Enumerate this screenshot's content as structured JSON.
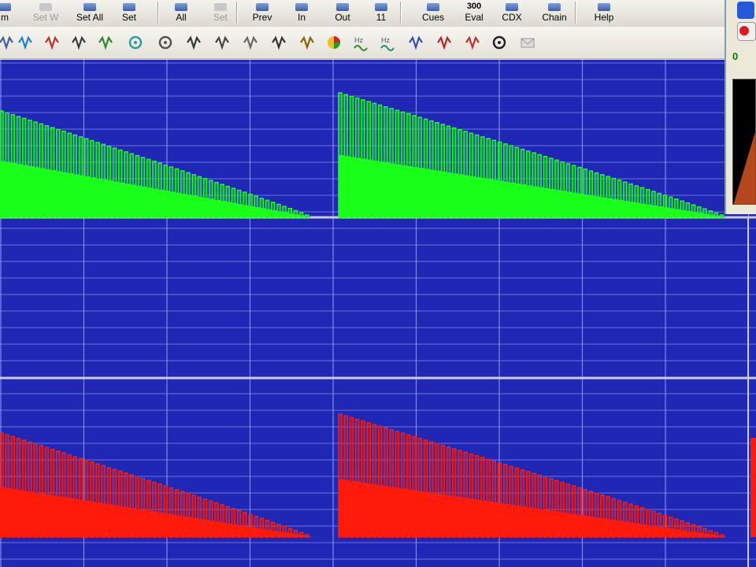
{
  "toolbar_top": {
    "buttons": [
      {
        "label": "m",
        "enabled": true
      },
      {
        "label": "Set W",
        "enabled": false
      },
      {
        "label": "Set All",
        "enabled": true
      },
      {
        "label": "Set",
        "enabled": true
      },
      {
        "label": "All",
        "enabled": true
      },
      {
        "label": "Set",
        "enabled": false
      },
      {
        "label": "Prev",
        "enabled": true
      },
      {
        "label": "In",
        "enabled": true
      },
      {
        "label": "Out",
        "enabled": true
      },
      {
        "label": "11",
        "enabled": true
      },
      {
        "label": "Cues",
        "enabled": true
      },
      {
        "label": "Eval",
        "enabled": true
      },
      {
        "label": "CDX",
        "enabled": true
      },
      {
        "label": "Chain",
        "enabled": true
      },
      {
        "label": "Help",
        "enabled": true
      }
    ],
    "eval_badge": "300"
  },
  "toolbar_tools": {
    "icons": [
      "waveform-icon",
      "antenna-icon",
      "network-icon",
      "wave-split-icon",
      "nb-icon",
      "target-icon",
      "circle-icon",
      "to-icon",
      "fo-icon",
      "probe-icon",
      "ol-icon",
      "magnifier-icon",
      "pie-icon",
      "hz-play-icon",
      "hz-wave-icon",
      "cycle-icon",
      "alert-icon",
      "ribbon-icon",
      "clock-icon",
      "mail-icon"
    ]
  },
  "side_panel": {
    "readout": "0"
  },
  "colors": {
    "plot_bg": "#1f27b4",
    "grid": "#a9b1ff",
    "channel_top": "#19ff19",
    "channel_bottom": "#ff1a0a",
    "divider": "#c9ccd8"
  },
  "channels": [
    {
      "name": "channel-top",
      "color_key": "channel_top",
      "bursts": [
        {
          "start": 0,
          "end": 395,
          "peak": 135,
          "floor": 0.53
        },
        {
          "start": 430,
          "end": 922,
          "peak": 158,
          "floor": 0.5
        }
      ]
    },
    {
      "name": "channel-bottom",
      "color_key": "channel_bottom",
      "bursts": [
        {
          "start": 0,
          "end": 395,
          "peak": 132,
          "floor": 0.48
        },
        {
          "start": 430,
          "end": 922,
          "peak": 156,
          "floor": 0.47
        }
      ]
    }
  ]
}
